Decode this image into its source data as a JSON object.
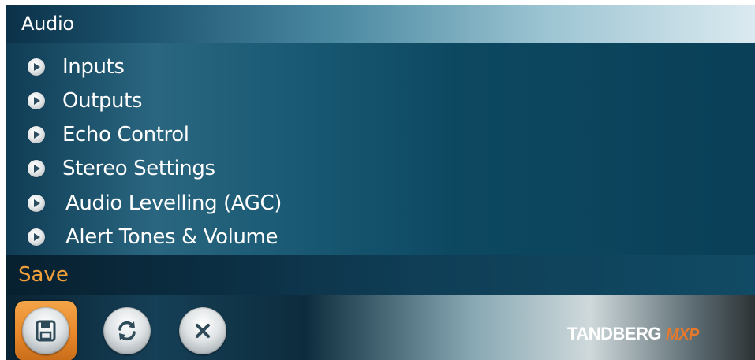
{
  "window": {
    "title": "Audio"
  },
  "menu": {
    "items": [
      {
        "label": "Inputs",
        "icon": "play-bullet-icon"
      },
      {
        "label": "Outputs",
        "icon": "play-bullet-icon"
      },
      {
        "label": "Echo Control",
        "icon": "play-bullet-icon"
      },
      {
        "label": "Stereo Settings",
        "icon": "play-bullet-icon"
      },
      {
        "label": "Audio Levelling (AGC)",
        "icon": "play-bullet-icon"
      },
      {
        "label": "Alert Tones & Volume",
        "icon": "play-bullet-icon"
      }
    ]
  },
  "status": {
    "focused_action": "Save"
  },
  "toolbar": {
    "buttons": [
      {
        "name": "save",
        "icon": "floppy-disk-icon",
        "selected": true
      },
      {
        "name": "refresh",
        "icon": "refresh-icon",
        "selected": false
      },
      {
        "name": "cancel",
        "icon": "close-icon",
        "selected": false
      }
    ]
  },
  "brand": {
    "name": "TANDBERG",
    "suffix": "MXP"
  },
  "colors": {
    "accent": "#f2a13a",
    "selection": "#e8882a",
    "panel": "#0f3e56"
  }
}
